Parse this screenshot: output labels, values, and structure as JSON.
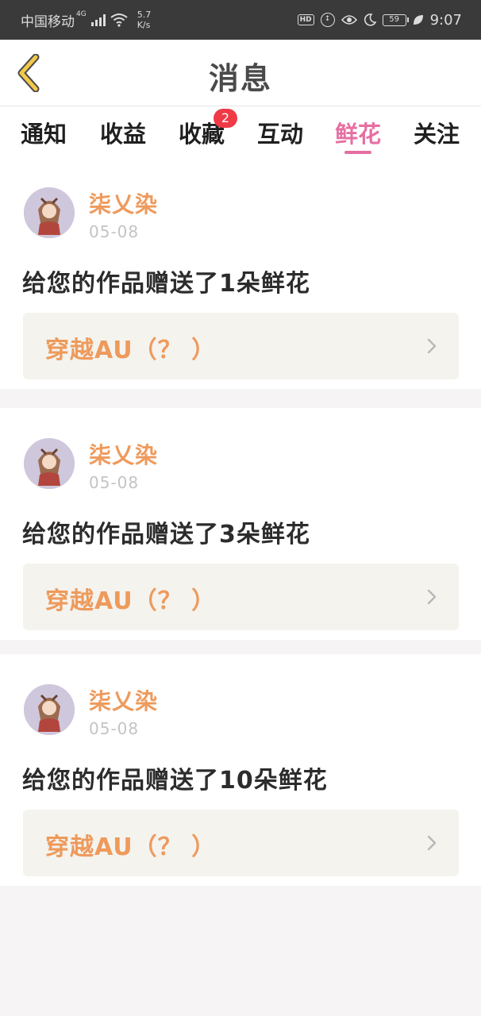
{
  "status_bar": {
    "carrier": "中国移动",
    "network": "4G",
    "speed_value": "5.7",
    "speed_unit": "K/s",
    "hd": "HD",
    "battery": "59",
    "time": "9:07"
  },
  "header": {
    "title": "消息",
    "back_icon": "chevron-left-icon",
    "back_color": "#f2c94c"
  },
  "tabs": [
    {
      "label": "通知",
      "active": false
    },
    {
      "label": "收益",
      "active": false
    },
    {
      "label": "收藏",
      "active": false,
      "badge": "2"
    },
    {
      "label": "互动",
      "active": false
    },
    {
      "label": "鲜花",
      "active": true
    },
    {
      "label": "关注",
      "active": false
    }
  ],
  "colors": {
    "accent": "#e66fa2",
    "name_orange": "#ee9a5c",
    "badge_red": "#f03a46"
  },
  "messages": [
    {
      "username": "柒乂染",
      "date": "05-08",
      "text": "给您的作品赠送了1朵鲜花",
      "work_title": "穿越AU（？ ）"
    },
    {
      "username": "柒乂染",
      "date": "05-08",
      "text": "给您的作品赠送了3朵鲜花",
      "work_title": "穿越AU（？ ）"
    },
    {
      "username": "柒乂染",
      "date": "05-08",
      "text": "给您的作品赠送了10朵鲜花",
      "work_title": "穿越AU（？ ）"
    }
  ]
}
